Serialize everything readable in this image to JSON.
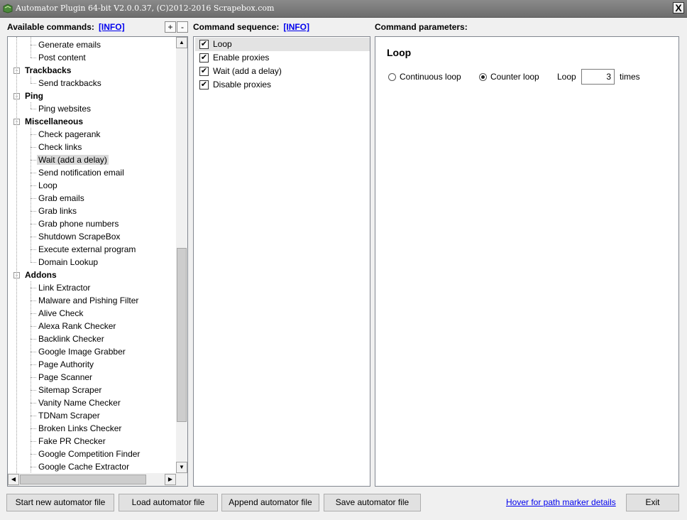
{
  "window": {
    "title": "Automator Plugin 64-bit V2.0.0.37, (C)2012-2016 Scrapebox.com",
    "close_label": "X"
  },
  "available": {
    "header": "Available commands:",
    "info_link": "[INFO]",
    "expand_label": "+",
    "collapse_label": "-",
    "tree": [
      {
        "label": "Generate emails",
        "level": 1
      },
      {
        "label": "Post content",
        "level": 1
      },
      {
        "label": "Trackbacks",
        "level": 0,
        "expander": "-"
      },
      {
        "label": "Send trackbacks",
        "level": 1
      },
      {
        "label": "Ping",
        "level": 0,
        "expander": "-"
      },
      {
        "label": "Ping websites",
        "level": 1
      },
      {
        "label": "Miscellaneous",
        "level": 0,
        "expander": "-"
      },
      {
        "label": "Check pagerank",
        "level": 1
      },
      {
        "label": "Check links",
        "level": 1
      },
      {
        "label": "Wait (add a delay)",
        "level": 1,
        "selected": true
      },
      {
        "label": "Send notification email",
        "level": 1
      },
      {
        "label": "Loop",
        "level": 1
      },
      {
        "label": "Grab emails",
        "level": 1
      },
      {
        "label": "Grab links",
        "level": 1
      },
      {
        "label": "Grab phone numbers",
        "level": 1
      },
      {
        "label": "Shutdown ScrapeBox",
        "level": 1
      },
      {
        "label": "Execute external program",
        "level": 1
      },
      {
        "label": "Domain Lookup",
        "level": 1
      },
      {
        "label": "Addons",
        "level": 0,
        "expander": "-"
      },
      {
        "label": "Link Extractor",
        "level": 1
      },
      {
        "label": "Malware and Pishing Filter",
        "level": 1
      },
      {
        "label": "Alive Check",
        "level": 1
      },
      {
        "label": "Alexa Rank Checker",
        "level": 1
      },
      {
        "label": "Backlink Checker",
        "level": 1
      },
      {
        "label": "Google Image Grabber",
        "level": 1
      },
      {
        "label": "Page Authority",
        "level": 1
      },
      {
        "label": "Page Scanner",
        "level": 1
      },
      {
        "label": "Sitemap Scraper",
        "level": 1
      },
      {
        "label": "Vanity Name Checker",
        "level": 1
      },
      {
        "label": "TDNam Scraper",
        "level": 1
      },
      {
        "label": "Broken Links Checker",
        "level": 1
      },
      {
        "label": "Fake PR Checker",
        "level": 1
      },
      {
        "label": "Google Competition Finder",
        "level": 1
      },
      {
        "label": "Google Cache Extractor",
        "level": 1
      }
    ]
  },
  "sequence": {
    "header": "Command sequence:",
    "info_link": "[INFO]",
    "items": [
      {
        "label": "Loop",
        "checked": true,
        "selected": true
      },
      {
        "label": "Enable proxies",
        "checked": true
      },
      {
        "label": "Wait (add a delay)",
        "checked": true
      },
      {
        "label": "Disable proxies",
        "checked": true
      }
    ]
  },
  "params": {
    "header": "Command parameters:",
    "title": "Loop",
    "continuous_label": "Continuous loop",
    "counter_label": "Counter loop",
    "selected_mode": "counter",
    "loop_label": "Loop",
    "loop_count": "3",
    "times_label": "times"
  },
  "buttons": {
    "start_new": "Start new automator file",
    "load": "Load automator file",
    "append": "Append automator file",
    "save": "Save automator file",
    "hover_link": "Hover for path marker details",
    "exit": "Exit"
  },
  "icons": {
    "check_mark": "✔",
    "scroll_up": "▲",
    "scroll_down": "▼",
    "scroll_left": "◀",
    "scroll_right": "▶"
  }
}
